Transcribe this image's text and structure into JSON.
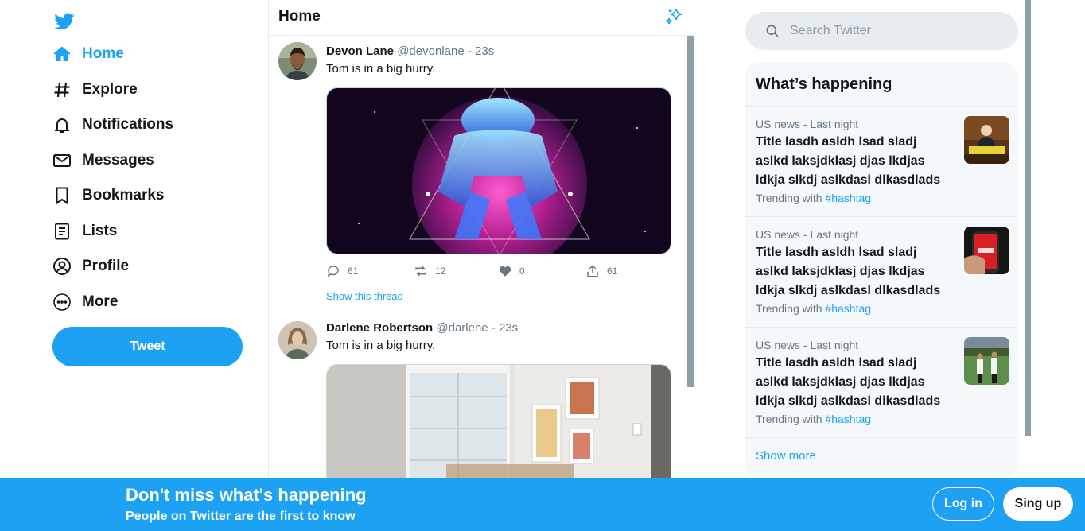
{
  "nav": {
    "items": [
      {
        "label": "Home",
        "icon": "home-icon",
        "active": true
      },
      {
        "label": "Explore",
        "icon": "hash-icon"
      },
      {
        "label": "Notifications",
        "icon": "bell-icon"
      },
      {
        "label": "Messages",
        "icon": "mail-icon"
      },
      {
        "label": "Bookmarks",
        "icon": "bookmark-icon"
      },
      {
        "label": "Lists",
        "icon": "list-icon"
      },
      {
        "label": "Profile",
        "icon": "user-icon"
      },
      {
        "label": "More",
        "icon": "more-icon"
      }
    ],
    "tweet_button": "Tweet"
  },
  "feed": {
    "title": "Home",
    "tweets": [
      {
        "name": "Devon Lane",
        "handle": "@devonlane",
        "time": "- 23s",
        "text": "Tom is in a big hurry.",
        "replies": "61",
        "retweets": "12",
        "likes": "0",
        "shares": "61",
        "show_thread": "Show this thread"
      },
      {
        "name": "Darlene Robertson",
        "handle": "@darlene",
        "time": "- 23s",
        "text": "Tom is in a big hurry."
      }
    ]
  },
  "search": {
    "placeholder": "Search Twitter"
  },
  "trends": {
    "title": "What’s happening",
    "items": [
      {
        "meta": "US news - Last night",
        "title": "Title lasdh asldh lsad sladj aslkd laksjdklasj djas lkdjas ldkja slkdj aslkdasl dlkasdlads",
        "tag_prefix": "Trending with",
        "tag": "#hashtag"
      },
      {
        "meta": "US news - Last night",
        "title": "Title lasdh asldh lsad sladj aslkd laksjdklasj djas lkdjas ldkja slkdj aslkdasl dlkasdlads",
        "tag_prefix": "Trending with",
        "tag": "#hashtag"
      },
      {
        "meta": "US news - Last night",
        "title": "Title lasdh asldh lsad sladj aslkd laksjdklasj djas lkdjas ldkja slkdj aslkdasl dlkasdlads",
        "tag_prefix": "Trending with",
        "tag": "#hashtag"
      }
    ],
    "show_more": "Show more"
  },
  "banner": {
    "title": "Don't miss what's happening",
    "subtitle": "People on Twitter are the first to know",
    "login": "Log in",
    "signup": "Sing up"
  },
  "colors": {
    "accent": "#1da1f2",
    "text": "#14171a",
    "muted": "#657786",
    "border": "#e6ecf0"
  }
}
